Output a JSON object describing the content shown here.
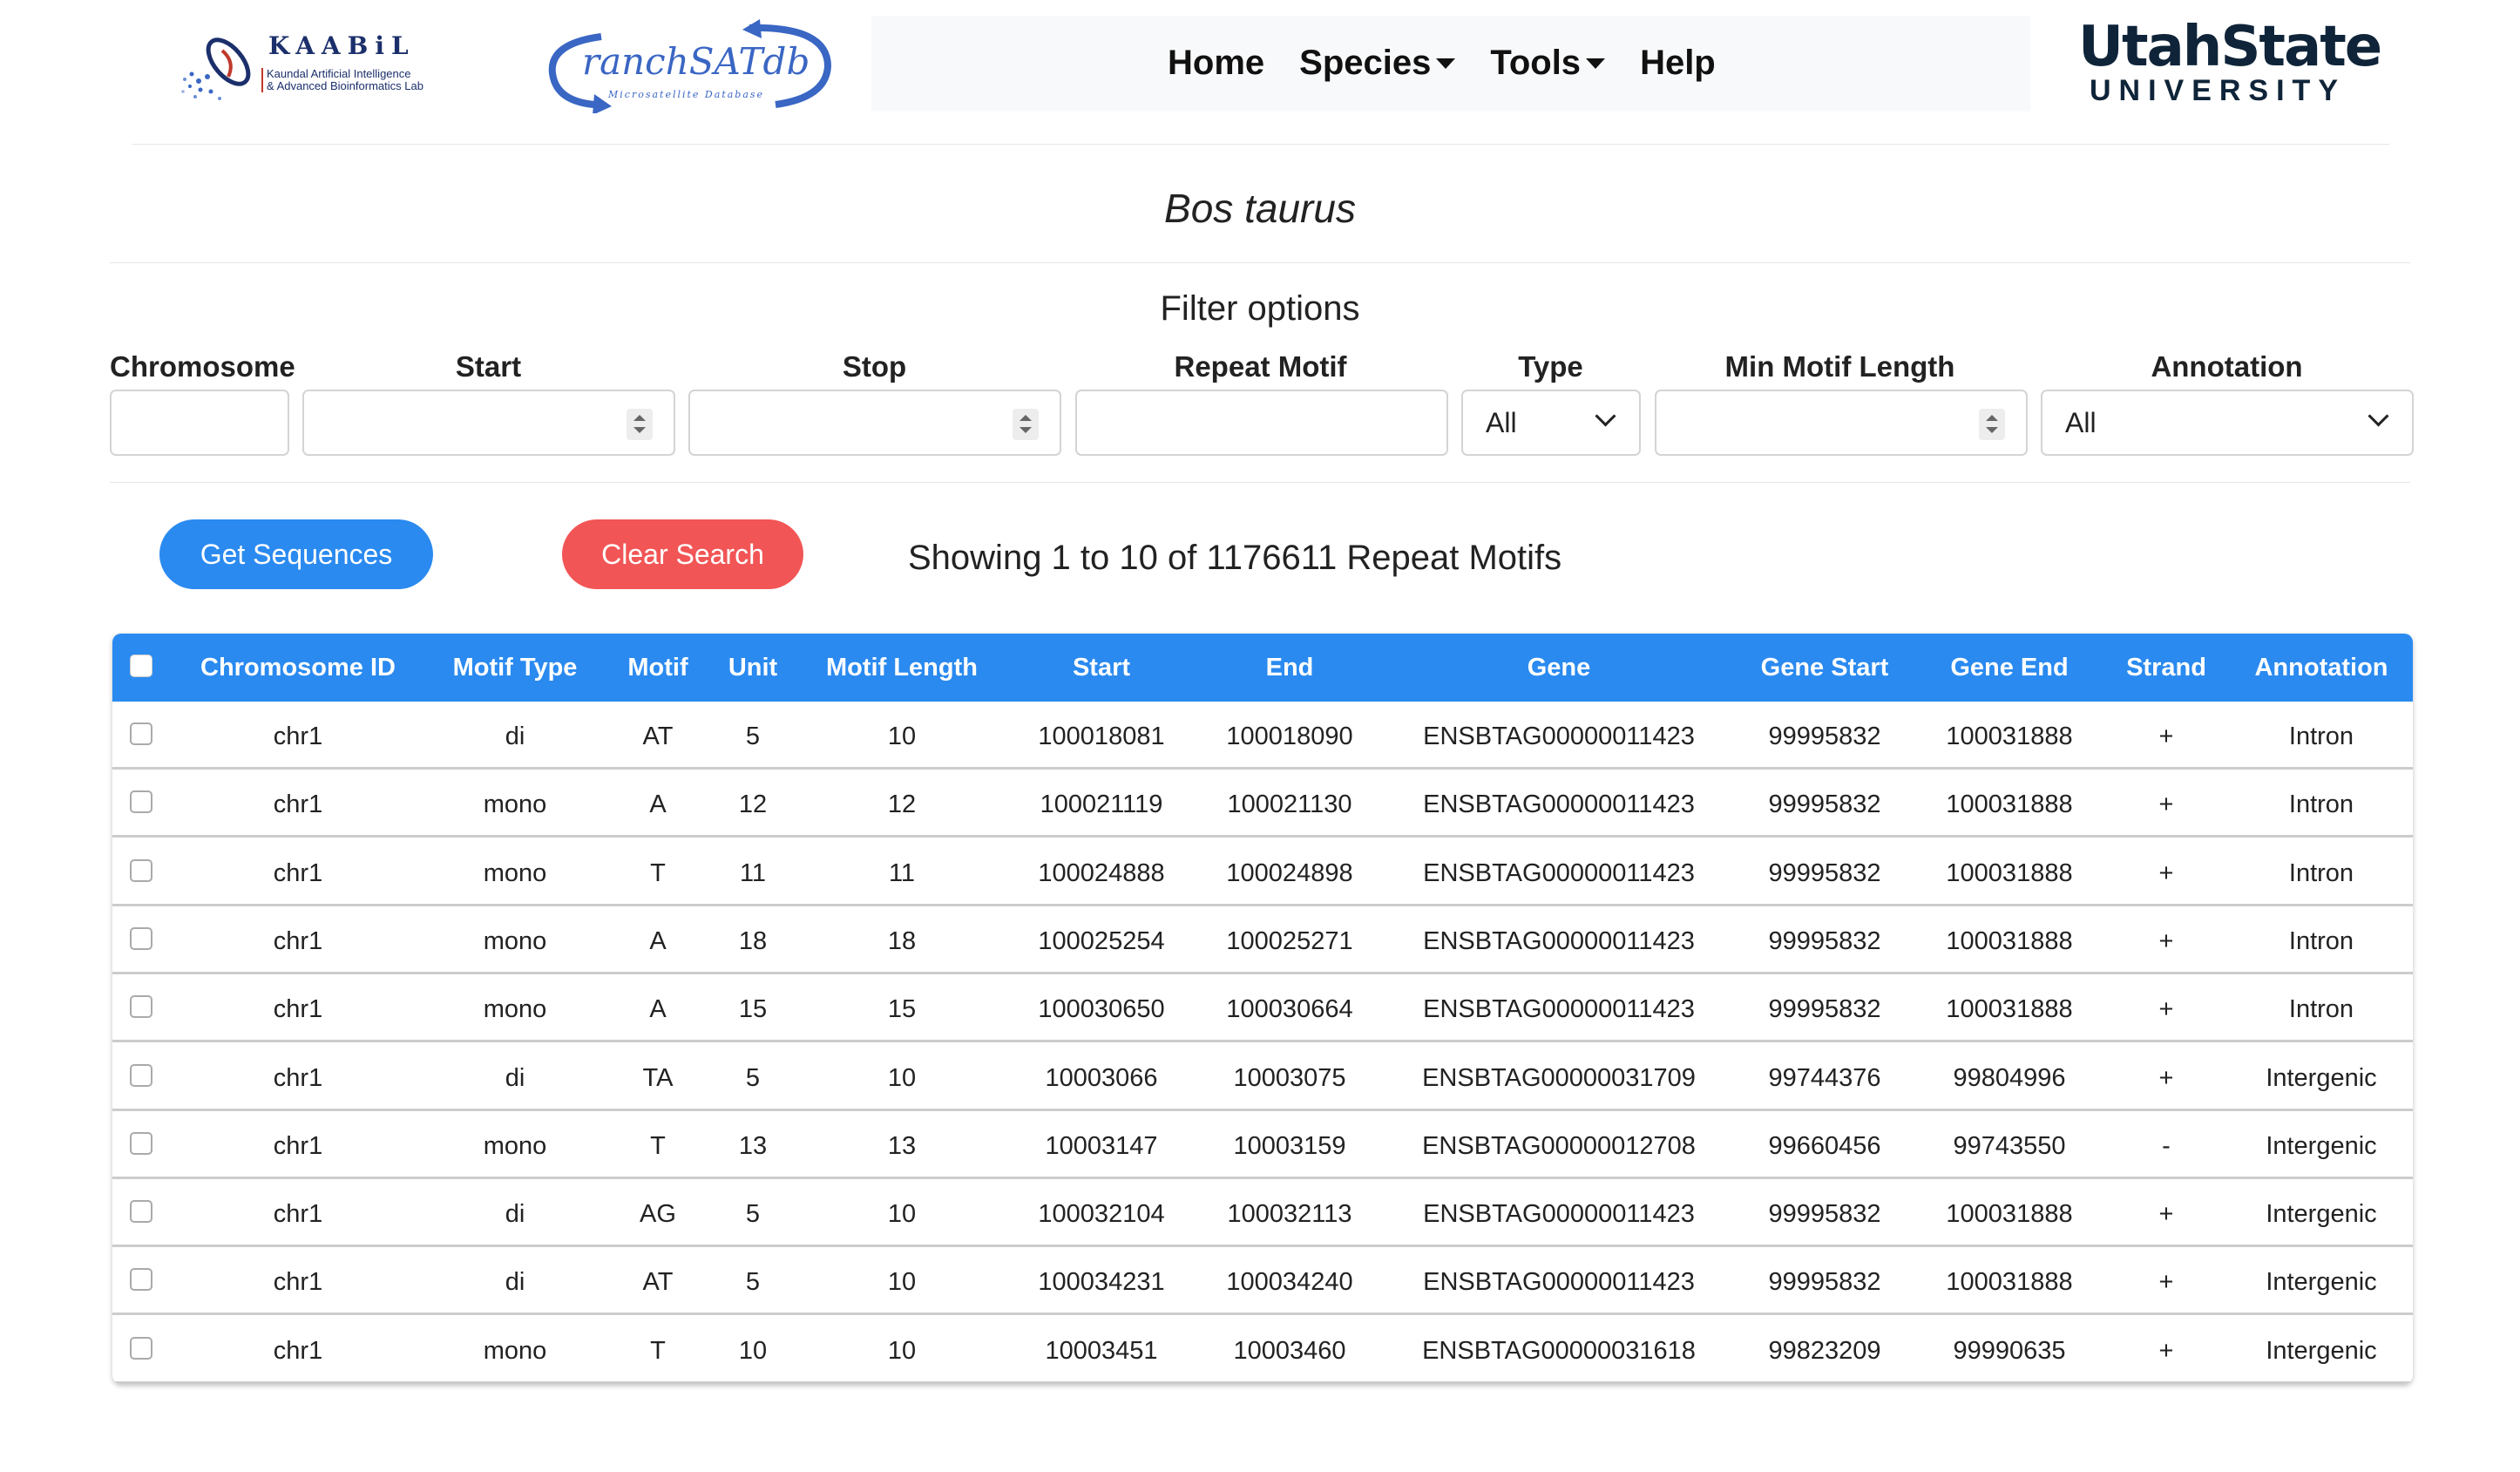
{
  "header": {
    "kaabil_title": "KAABiL",
    "kaabil_sub1": "Kaundal Artificial Intelligence",
    "kaabil_sub2": "& Advanced Bioinformatics Lab",
    "ranch_title": "ranchSATdb",
    "ranch_sub": "Microsatellite Database",
    "nav": {
      "home": "Home",
      "species": "Species",
      "tools": "Tools",
      "help": "Help"
    },
    "usu_line1": "UtahState",
    "usu_line2": "UNIVERSITY"
  },
  "species_title": "Bos taurus",
  "filters": {
    "title": "Filter options",
    "chromosome_label": "Chromosome",
    "chromosome_value": "",
    "start_label": "Start",
    "start_value": "",
    "stop_label": "Stop",
    "stop_value": "",
    "repeat_motif_label": "Repeat Motif",
    "repeat_motif_value": "",
    "type_label": "Type",
    "type_value": "All",
    "min_motif_length_label": "Min Motif Length",
    "min_motif_length_value": "",
    "annotation_label": "Annotation",
    "annotation_value": "All"
  },
  "actions": {
    "get_sequences": "Get Sequences",
    "clear_search": "Clear Search",
    "showing": "Showing 1 to 10 of 1176611 Repeat Motifs"
  },
  "colors": {
    "primary_blue": "#2a8af0",
    "danger_red": "#f25555",
    "usu_navy": "#0f2439"
  },
  "table": {
    "columns": [
      "Chromosome ID",
      "Motif Type",
      "Motif",
      "Unit",
      "Motif Length",
      "Start",
      "End",
      "Gene",
      "Gene Start",
      "Gene End",
      "Strand",
      "Annotation"
    ],
    "rows": [
      [
        "chr1",
        "di",
        "AT",
        "5",
        "10",
        "100018081",
        "100018090",
        "ENSBTAG00000011423",
        "99995832",
        "100031888",
        "+",
        "Intron"
      ],
      [
        "chr1",
        "mono",
        "A",
        "12",
        "12",
        "100021119",
        "100021130",
        "ENSBTAG00000011423",
        "99995832",
        "100031888",
        "+",
        "Intron"
      ],
      [
        "chr1",
        "mono",
        "T",
        "11",
        "11",
        "100024888",
        "100024898",
        "ENSBTAG00000011423",
        "99995832",
        "100031888",
        "+",
        "Intron"
      ],
      [
        "chr1",
        "mono",
        "A",
        "18",
        "18",
        "100025254",
        "100025271",
        "ENSBTAG00000011423",
        "99995832",
        "100031888",
        "+",
        "Intron"
      ],
      [
        "chr1",
        "mono",
        "A",
        "15",
        "15",
        "100030650",
        "100030664",
        "ENSBTAG00000011423",
        "99995832",
        "100031888",
        "+",
        "Intron"
      ],
      [
        "chr1",
        "di",
        "TA",
        "5",
        "10",
        "10003066",
        "10003075",
        "ENSBTAG00000031709",
        "99744376",
        "99804996",
        "+",
        "Intergenic"
      ],
      [
        "chr1",
        "mono",
        "T",
        "13",
        "13",
        "10003147",
        "10003159",
        "ENSBTAG00000012708",
        "99660456",
        "99743550",
        "-",
        "Intergenic"
      ],
      [
        "chr1",
        "di",
        "AG",
        "5",
        "10",
        "100032104",
        "100032113",
        "ENSBTAG00000011423",
        "99995832",
        "100031888",
        "+",
        "Intergenic"
      ],
      [
        "chr1",
        "di",
        "AT",
        "5",
        "10",
        "100034231",
        "100034240",
        "ENSBTAG00000011423",
        "99995832",
        "100031888",
        "+",
        "Intergenic"
      ],
      [
        "chr1",
        "mono",
        "T",
        "10",
        "10",
        "10003451",
        "10003460",
        "ENSBTAG00000031618",
        "99823209",
        "99990635",
        "+",
        "Intergenic"
      ]
    ]
  }
}
